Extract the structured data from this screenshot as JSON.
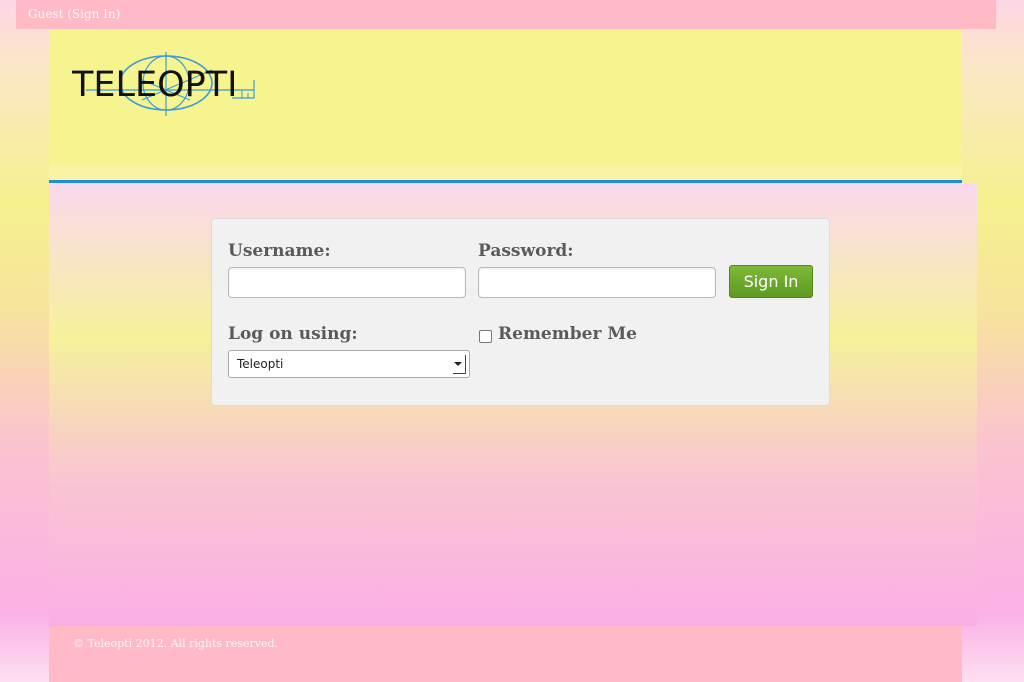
{
  "topbar": {
    "signin_link": "Guest (Sign In)"
  },
  "header": {
    "logo_text": "TELEOPTI",
    "logo_color": "#111111",
    "logo_accent_color": "#3a9ad9"
  },
  "login_form": {
    "username_label": "Username:",
    "username_value": "",
    "password_label": "Password:",
    "password_value": "",
    "sign_in_button": "Sign In",
    "log_on_using_label": "Log on using:",
    "log_on_using_value": "Teleopti",
    "remember_me_label": "Remember Me",
    "remember_me_checked": false
  },
  "footer": {
    "copyright": "© Teleopti 2012. All rights reserved."
  },
  "colors": {
    "rule": "#1e8ed8",
    "button": "#6aa82c",
    "topbar": "#ffbac6",
    "header": "#f6f48e"
  }
}
